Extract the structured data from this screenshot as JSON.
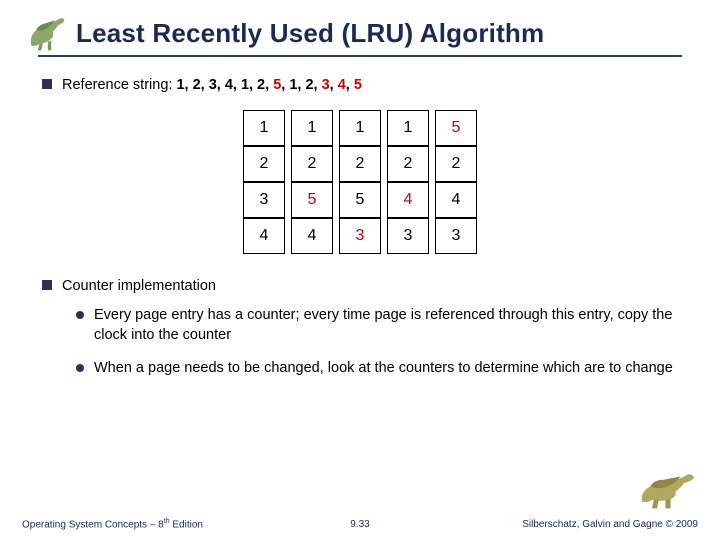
{
  "title": "Least Recently Used (LRU) Algorithm",
  "ref": {
    "label": "Reference string:  ",
    "seq_plain": "1, 2, 3, 4, 1, 2, ",
    "seq_r1": "5",
    "seq_mid": ", 1, 2, ",
    "seq_r2": "3",
    "seq_c": ", ",
    "seq_r3": "4",
    "seq_c2": ", ",
    "seq_r4": "5"
  },
  "table": {
    "rows": [
      [
        {
          "v": "1"
        },
        {
          "v": "1"
        },
        {
          "v": "1"
        },
        {
          "v": "1"
        },
        {
          "v": "5",
          "red": true
        }
      ],
      [
        {
          "v": "2"
        },
        {
          "v": "2"
        },
        {
          "v": "2"
        },
        {
          "v": "2"
        },
        {
          "v": "2"
        }
      ],
      [
        {
          "v": "3"
        },
        {
          "v": "5",
          "red": true
        },
        {
          "v": "5"
        },
        {
          "v": "4",
          "red": true
        },
        {
          "v": "4"
        }
      ],
      [
        {
          "v": "4"
        },
        {
          "v": "4"
        },
        {
          "v": "3",
          "red": true
        },
        {
          "v": "3"
        },
        {
          "v": "3"
        }
      ]
    ]
  },
  "section2": {
    "heading": "Counter implementation",
    "items": [
      "Every page entry has a counter; every time page is referenced through this entry, copy the clock into the counter",
      "When a page needs to be changed, look at the counters to determine which are to change"
    ]
  },
  "footer": {
    "left_a": "Operating System Concepts – 8",
    "left_sup": "th",
    "left_b": " Edition",
    "center": "9.33",
    "right": "Silberschatz, Galvin and Gagne © 2009"
  }
}
